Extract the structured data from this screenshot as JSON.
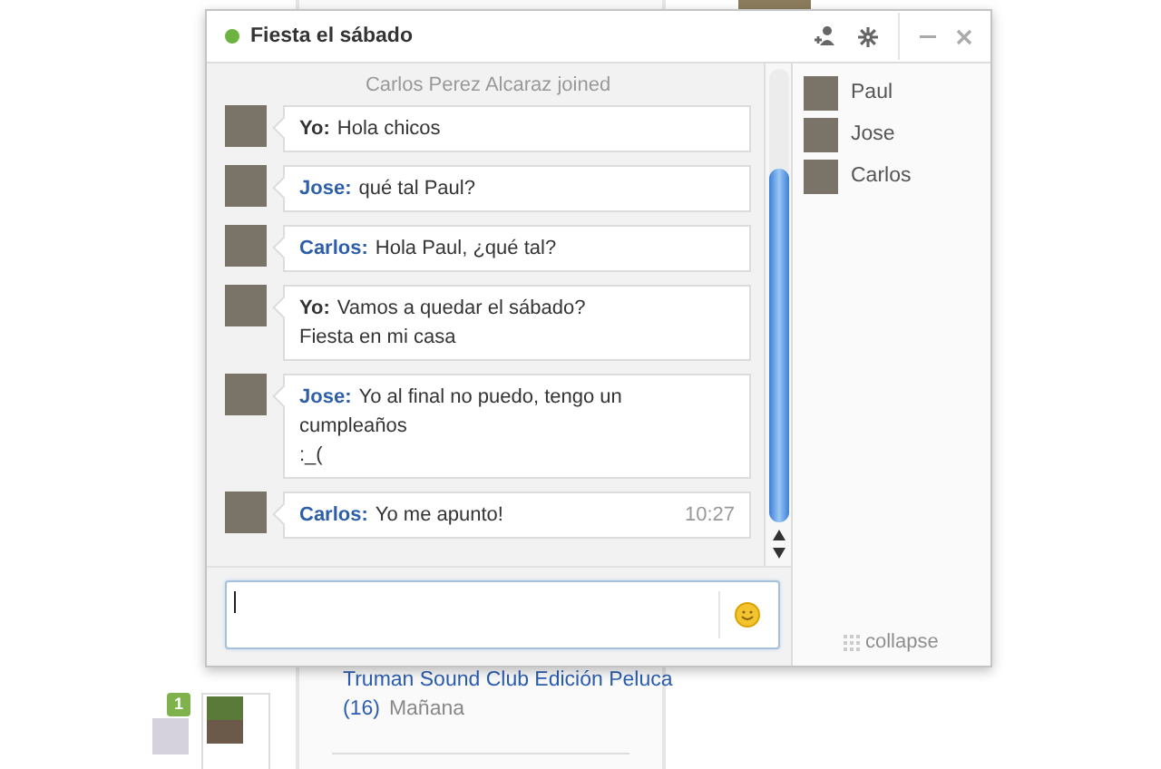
{
  "window": {
    "title": "Fiesta el sábado",
    "online": true
  },
  "system_message": "Carlos Perez Alcaraz joined",
  "messages": [
    {
      "sender": "Yo:",
      "self": true,
      "lines": [
        "Hola chicos"
      ]
    },
    {
      "sender": "Jose:",
      "self": false,
      "lines": [
        "qué tal Paul?"
      ]
    },
    {
      "sender": "Carlos:",
      "self": false,
      "lines": [
        "Hola Paul, ¿qué tal?"
      ]
    },
    {
      "sender": "Yo:",
      "self": true,
      "lines": [
        "Vamos a quedar el sábado?",
        "Fiesta en mi casa"
      ]
    },
    {
      "sender": "Jose:",
      "self": false,
      "lines": [
        "Yo al final no puedo, tengo un",
        "cumpleaños",
        ":_("
      ]
    },
    {
      "sender": "Carlos:",
      "self": false,
      "lines": [
        "Yo me apunto!"
      ],
      "time": "10:27"
    }
  ],
  "participants": [
    {
      "name": "Paul"
    },
    {
      "name": "Jose"
    },
    {
      "name": "Carlos"
    }
  ],
  "collapse_label": "collapse",
  "background": {
    "event_title": "Truman Sound Club Edición Peluca",
    "event_count": "(16)",
    "event_day": "Mañana",
    "tray_badge": "1"
  }
}
